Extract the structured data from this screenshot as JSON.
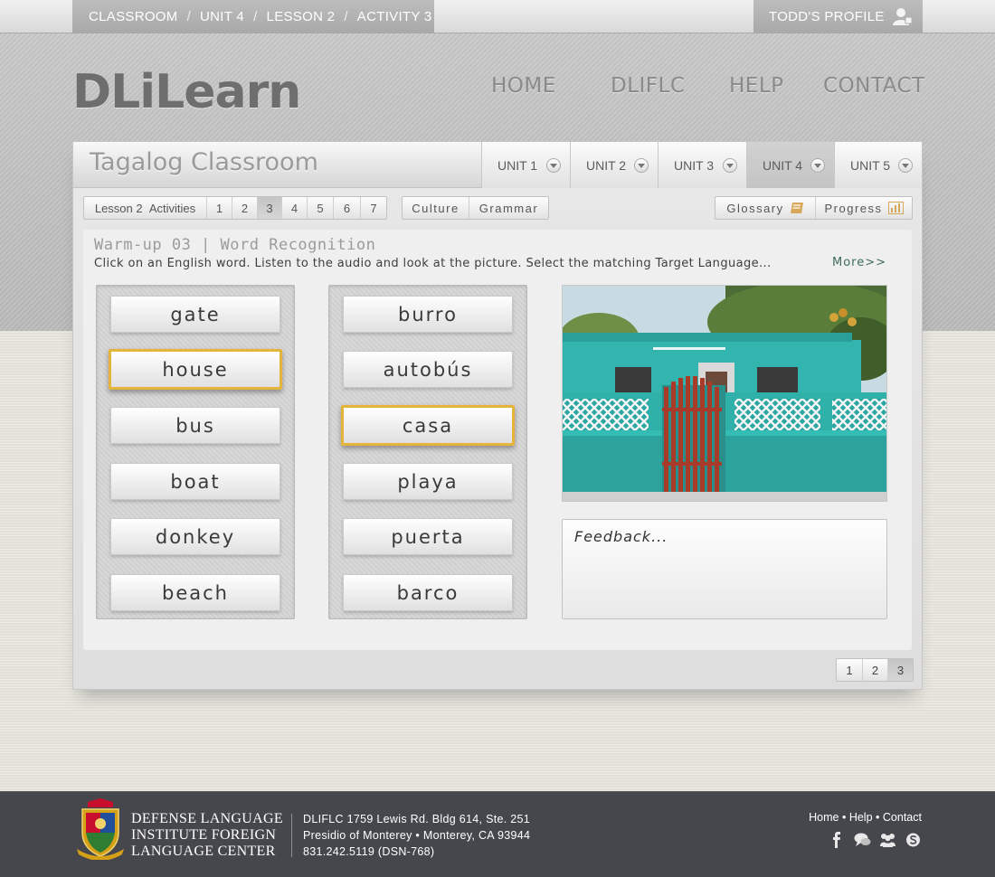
{
  "breadcrumb": [
    {
      "label": "CLASSROOM"
    },
    {
      "label": "UNIT 4"
    },
    {
      "label": "LESSON 2"
    },
    {
      "label": "ACTIVITY 3"
    }
  ],
  "breadcrumb_separator": "/",
  "profile": {
    "label": "TODD'S PROFILE",
    "icon": "user-icon"
  },
  "logo": "DLiLearn",
  "nav": [
    {
      "label": "HOME"
    },
    {
      "label": "DLIFLC"
    },
    {
      "label": "HELP"
    },
    {
      "label": "CONTACT"
    }
  ],
  "classroom": {
    "title": "Tagalog Classroom",
    "units": [
      {
        "label": "UNIT 1",
        "active": false
      },
      {
        "label": "UNIT 2",
        "active": false
      },
      {
        "label": "UNIT 3",
        "active": false
      },
      {
        "label": "UNIT 4",
        "active": true
      },
      {
        "label": "UNIT 5",
        "active": false
      }
    ]
  },
  "lesson_bar": {
    "lesson_label": "Lesson 2",
    "activities_label": "Activities",
    "activities": [
      "1",
      "2",
      "3",
      "4",
      "5",
      "6",
      "7"
    ],
    "selected_activity": "3"
  },
  "topic_bar": {
    "culture": "Culture",
    "grammar": "Grammar"
  },
  "tools": {
    "glossary": "Glossary",
    "glossary_icon": "book-icon",
    "progress": "Progress",
    "progress_icon": "bar-chart-icon",
    "icon_color": "#d8a85a"
  },
  "activity": {
    "title": "Warm-up 03 | Word Recognition",
    "instructions": "Click on an English word. Listen to the audio and look at the picture. Select the matching Target Language...",
    "more": "More>>",
    "english_words": [
      "gate",
      "house",
      "bus",
      "boat",
      "donkey",
      "beach"
    ],
    "selected_english": "house",
    "target_words": [
      "burro",
      "autobús",
      "casa",
      "playa",
      "puerta",
      "barco"
    ],
    "selected_target": "casa",
    "highlight_color": "#e5b43a",
    "feedback": "Feedback..."
  },
  "pager": {
    "pages": [
      "1",
      "2",
      "3"
    ],
    "selected": "3"
  },
  "footer": {
    "institute_lines": [
      "DEFENSE LANGUAGE",
      "INSTITUTE FOREIGN",
      "LANGUAGE CENTER"
    ],
    "address_lines": [
      "DLIFLC 1759 Lewis Rd. Bldg 614, Ste. 251",
      "Presidio of Monterey • Monterey, CA 93944",
      "831.242.5119 (DSN-768)"
    ],
    "links": [
      "Home",
      "Help",
      "Contact"
    ],
    "link_separator": "•",
    "social_icons": [
      "facebook-icon",
      "chat-icon",
      "group-icon",
      "skype-icon"
    ]
  }
}
